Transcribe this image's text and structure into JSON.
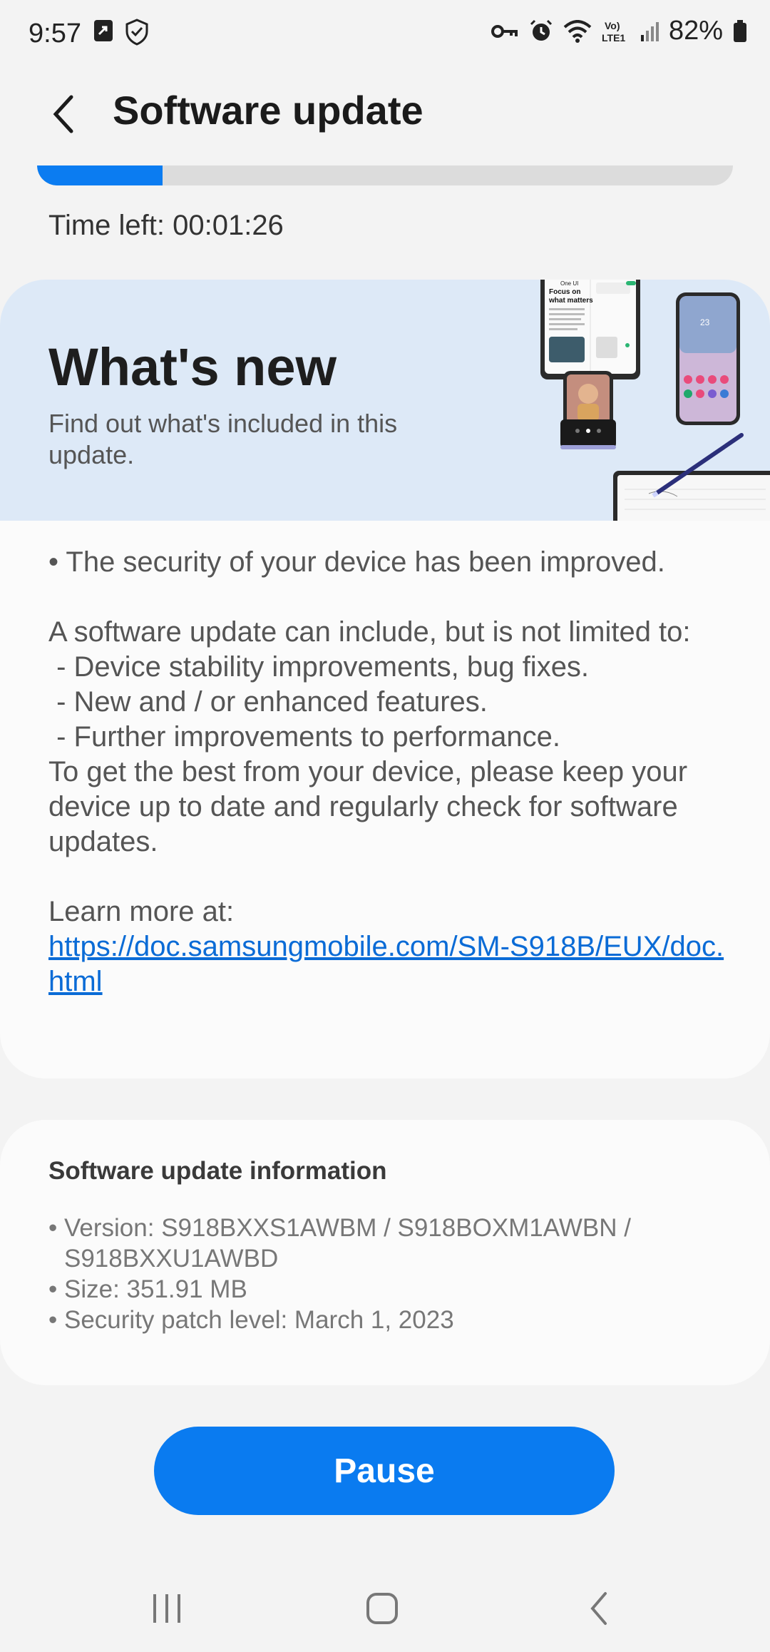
{
  "status_bar": {
    "time": "9:57",
    "battery_text": "82%",
    "icons": [
      "sync-icon",
      "shield-check-icon",
      "vpn-key-icon",
      "alarm-icon",
      "wifi-icon",
      "volte-icon",
      "signal-icon",
      "battery-icon"
    ]
  },
  "app_bar": {
    "title": "Software update",
    "back_icon": "back-chevron-icon"
  },
  "progress": {
    "fraction": 0.18,
    "time_left": "Time left: 00:01:26",
    "accent_color": "#0b7cf1"
  },
  "whats_new": {
    "title": "What's new",
    "subtitle": "Find out what's included in this update.",
    "hero_bg": "#dde9f7",
    "phone_art_text": {
      "line1": "One UI",
      "line2": "Focus on",
      "line3": "what matters",
      "clock": "23"
    }
  },
  "release_notes": {
    "security_line": "• The security of your device has been improved.",
    "intro": "A software update can include, but is not limited to:",
    "items": [
      " - Device stability improvements, bug fixes.",
      " - New and / or enhanced features.",
      " - Further improvements to performance."
    ],
    "closing": "To get the best from your device, please keep your device up to date and regularly check for software updates.",
    "learn_more": "Learn more at:",
    "link": "https://doc.samsungmobile.com/SM-S918B/EUX/doc.html"
  },
  "info": {
    "title": "Software update information",
    "version": "Version: S918BXXS1AWBM / S918BOXM1AWBN / S918BXXU1AWBD",
    "size": "Size: 351.91 MB",
    "security_patch": "Security patch level: March 1, 2023"
  },
  "actions": {
    "pause_label": "Pause",
    "button_color": "#0a7bf0"
  },
  "nav_bar": {
    "icons": [
      "recent-apps-icon",
      "home-icon",
      "back-icon"
    ]
  }
}
